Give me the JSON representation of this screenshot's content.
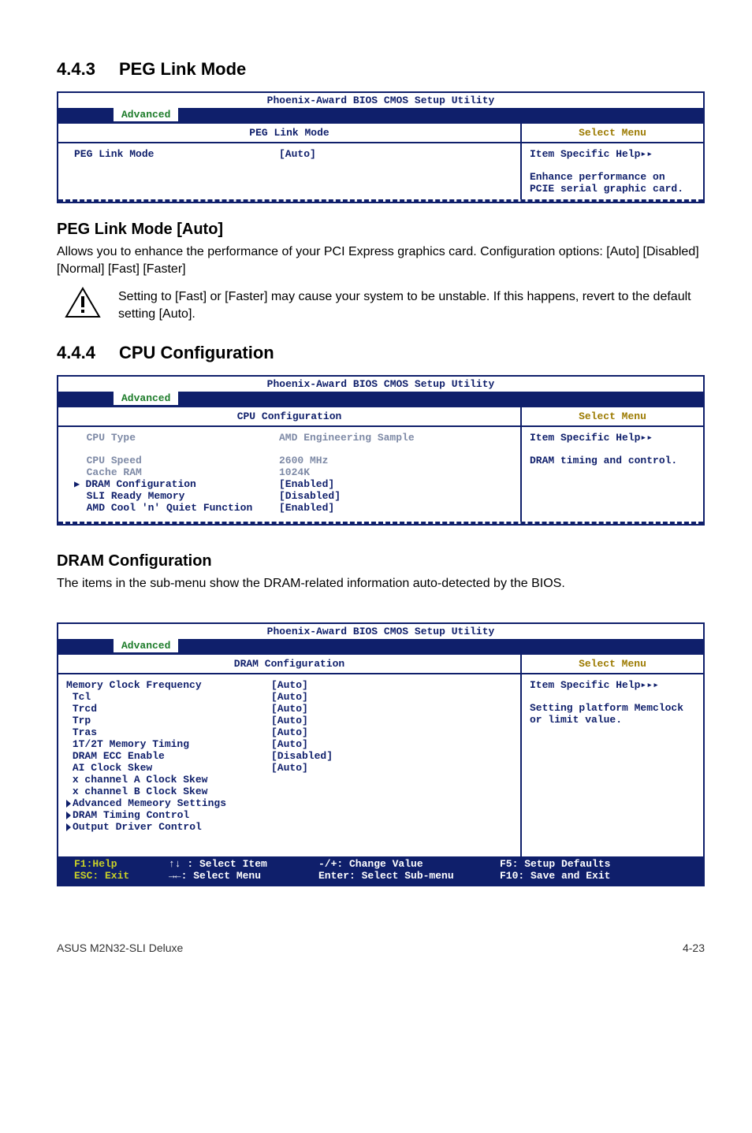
{
  "sec443": {
    "num": "4.4.3",
    "title": "PEG Link Mode"
  },
  "bios1": {
    "title": "Phoenix-Award BIOS CMOS Setup Utility",
    "tab": "Advanced",
    "head_left": "PEG Link Mode",
    "head_right": "Select Menu",
    "item_label": "PEG Link Mode",
    "item_value": "[Auto]",
    "help_title": "Item Specific Help▸▸",
    "help_body1": "Enhance performance on",
    "help_body2": "PCIE serial graphic card."
  },
  "peg_sub": "PEG Link Mode  [Auto]",
  "peg_body": "Allows you to enhance the performance of your PCI Express graphics card. Configuration options: [Auto] [Disabled] [Normal] [Fast] [Faster]",
  "warn_note": "Setting to [Fast] or [Faster] may cause your system to be unstable. If this happens, revert to the default setting [Auto].",
  "sec444": {
    "num": "4.4.4",
    "title": "CPU Configuration"
  },
  "bios2": {
    "title": "Phoenix-Award BIOS CMOS Setup Utility",
    "tab": "Advanced",
    "head_left": "CPU Configuration",
    "head_right": "Select Menu",
    "rows": [
      {
        "lbl": "CPU Type",
        "val": "AMD Engineering Sample",
        "dim": true
      },
      {
        "lbl": "",
        "val": "",
        "gap": true
      },
      {
        "lbl": "CPU Speed",
        "val": "2600 MHz",
        "dim": true
      },
      {
        "lbl": "Cache RAM",
        "val": "1024K",
        "dim": true
      },
      {
        "lbl": "DRAM Configuration",
        "val": "[Enabled]",
        "ptr": true
      },
      {
        "lbl": "SLI Ready Memory",
        "val": "[Disabled]"
      },
      {
        "lbl": "AMD Cool 'n' Quiet Function",
        "val": "[Enabled]"
      }
    ],
    "help_title": "Item Specific Help▸▸",
    "help_body": "DRAM timing and control."
  },
  "dram_sub": "DRAM Configuration",
  "dram_body": "The items in the sub-menu show the DRAM-related information auto-detected by the BIOS.",
  "bios3": {
    "title": "Phoenix-Award BIOS CMOS Setup Utility",
    "tab": "Advanced",
    "head_left": "DRAM Configuration",
    "head_right": "Select Menu",
    "rows": [
      {
        "lbl": "Memory Clock Frequency",
        "val": "[Auto]"
      },
      {
        "lbl": "Tcl",
        "val": "[Auto]",
        "indent": true
      },
      {
        "lbl": "Trcd",
        "val": "[Auto]",
        "indent": true
      },
      {
        "lbl": "Trp",
        "val": "[Auto]",
        "indent": true
      },
      {
        "lbl": "Tras",
        "val": "[Auto]",
        "indent": true
      },
      {
        "lbl": "1T/2T Memory Timing",
        "val": "[Auto]",
        "indent": true
      },
      {
        "lbl": "DRAM ECC Enable",
        "val": "[Disabled]",
        "indent": true
      },
      {
        "lbl": "AI Clock Skew",
        "val": "[Auto]",
        "indent": true
      },
      {
        "lbl": "x channel A Clock Skew",
        "val": "",
        "indent": true
      },
      {
        "lbl": "x channel B Clock Skew",
        "val": "",
        "indent": true
      },
      {
        "lbl": "Advanced Memeory Settings",
        "val": "",
        "sub": true,
        "indent": true
      },
      {
        "lbl": "DRAM Timing Control",
        "val": "",
        "sub": true,
        "indent": true
      },
      {
        "lbl": "Output Driver Control",
        "val": "",
        "sub": true,
        "indent": true
      }
    ],
    "help_title": "Item Specific Help▸▸▸",
    "help_body1": "Setting platform Memclock",
    "help_body2": "or limit value.",
    "keys": {
      "a1": "F1:Help",
      "a2": "ESC: Exit",
      "b1": "↑↓ : Select Item",
      "b2": "→←: Select Menu",
      "c1": "-/+: Change Value",
      "c2": "Enter: Select Sub-menu",
      "d1": "F5: Setup Defaults",
      "d2": "F10: Save and Exit"
    }
  },
  "footer": {
    "left": "ASUS M2N32-SLI Deluxe",
    "right": "4-23"
  }
}
